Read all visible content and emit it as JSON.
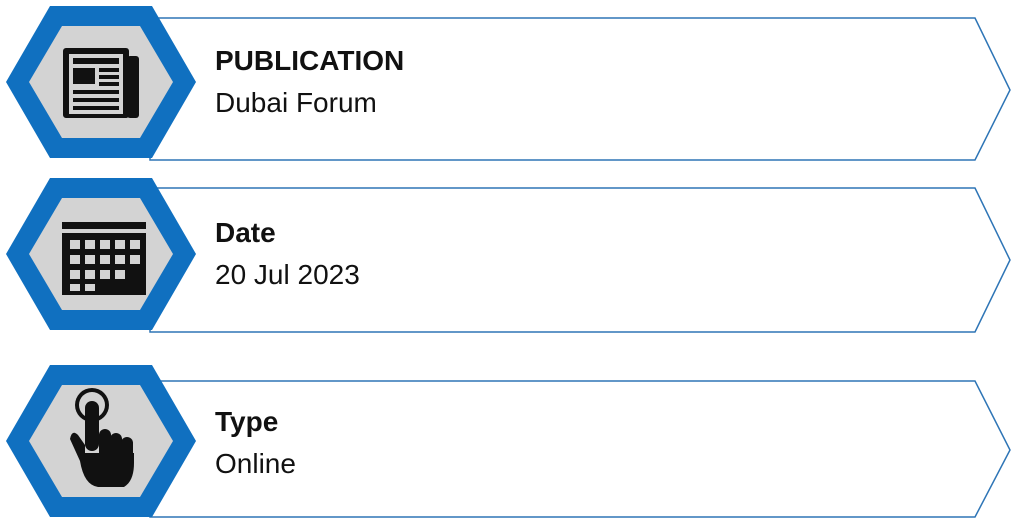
{
  "theme": {
    "accent": "#1070C0",
    "hex_fill": "#D3D3D3",
    "icon_color": "#111111"
  },
  "rows": [
    {
      "label": "PUBLICATION",
      "value": "Dubai Forum",
      "icon": "newspaper-icon"
    },
    {
      "label": "Date",
      "value": "20 Jul 2023",
      "icon": "calendar-icon"
    },
    {
      "label": "Type",
      "value": "Online",
      "icon": "pointing-hand-icon"
    }
  ]
}
